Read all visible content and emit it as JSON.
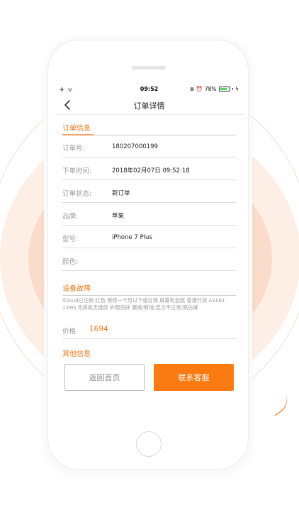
{
  "status_bar": {
    "left": "✈ ᯤ",
    "time": "09:52",
    "icons": "⊕ ⏰",
    "battery_text": "78%",
    "battery_level": 0.78,
    "charging": "ϟ"
  },
  "nav": {
    "title": "订单详情",
    "back_icon": "chevron-left-icon"
  },
  "order_section": {
    "title": "订单信息",
    "rows": [
      {
        "label": "订单号:",
        "value": "180207000199"
      },
      {
        "label": "下单时间:",
        "value": "2018年02月07日 09:52:18"
      },
      {
        "label": "订单状态:",
        "value": "新订单"
      },
      {
        "label": "品牌:",
        "value": "苹果"
      },
      {
        "label": "型号:",
        "value": "iPhone 7 Plus"
      },
      {
        "label": "颜色:",
        "value": ""
      }
    ]
  },
  "fault_section": {
    "title": "设备故障",
    "description": "iCloud已注销 红色 保修一个月以下或过保 屏幕有划痕 香港行货 A1661 128G 无拆机无维修 外观完好 漏液/断线/显示不正常/高仿屏",
    "price_label": "价格",
    "price_value": "1694"
  },
  "other_section": {
    "title": "其他信息"
  },
  "buttons": {
    "home": "返回首页",
    "service": "联系客服"
  },
  "colors": {
    "accent": "#f27a1a",
    "button_primary": "#fb7a12"
  }
}
